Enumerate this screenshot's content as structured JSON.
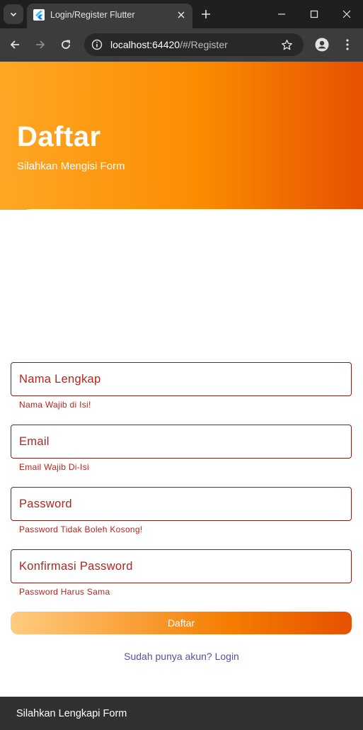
{
  "browser": {
    "tab_title": "Login/Register Flutter",
    "url_host": "localhost:64420",
    "url_path": "/#/Register"
  },
  "header": {
    "title": "Daftar",
    "subtitle": "Silahkan Mengisi Form"
  },
  "form": {
    "fields": [
      {
        "placeholder": "Nama Lengkap",
        "value": "",
        "error": "Nama Wajib di Isi!"
      },
      {
        "placeholder": "Email",
        "value": "",
        "error": "Email Wajib Di-Isi"
      },
      {
        "placeholder": "Password",
        "value": "",
        "error": "Password Tidak Boleh Kosong!"
      },
      {
        "placeholder": "Konfirmasi Password",
        "value": "",
        "error": "Password Harus Sama"
      }
    ],
    "submit_label": "Daftar",
    "login_link": "Sudah punya akun? Login"
  },
  "snackbar": {
    "text": "Silahkan Lengkapi Form"
  },
  "colors": {
    "header_gradient": [
      "#ffa726",
      "#e65100"
    ],
    "error": "#b3261e",
    "link": "#5c4d9e"
  }
}
